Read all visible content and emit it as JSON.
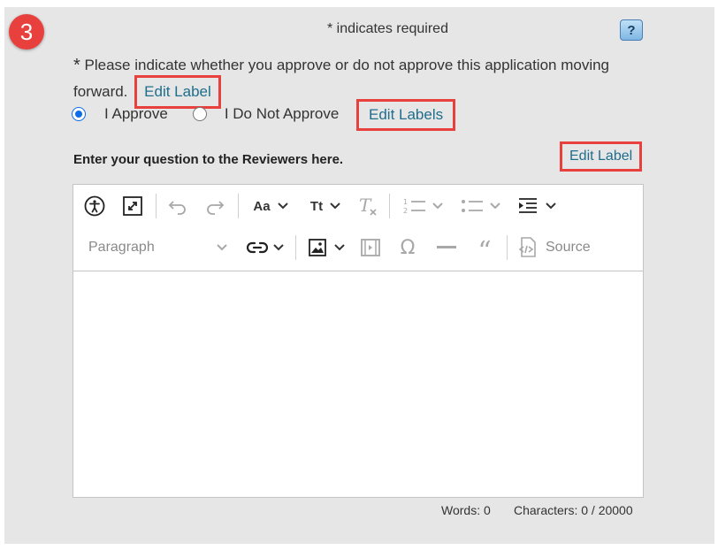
{
  "step_number": "3",
  "required_note": "* indicates required",
  "help_button_label": "?",
  "question": {
    "star": "*",
    "text": "Please indicate whether you approve or do not approve this application moving forward.",
    "edit_link": "Edit Label"
  },
  "radio_options": [
    {
      "label": "I Approve",
      "checked": true
    },
    {
      "label": "I Do Not Approve",
      "checked": false
    }
  ],
  "edit_labels_link": "Edit Labels",
  "reviewer_label": "Enter your question to the Reviewers here.",
  "reviewer_edit_link": "Edit Label",
  "editor": {
    "font_size_label": "Aa",
    "text_style_label": "Tt",
    "heading_select": "Paragraph",
    "source_label": "Source",
    "icons": [
      "accessibility-icon",
      "fullscreen-icon",
      "undo-icon",
      "redo-icon",
      "font-size-icon",
      "text-style-icon",
      "remove-format-icon",
      "numbered-list-icon",
      "bulleted-list-icon",
      "indent-icon",
      "link-icon",
      "image-icon",
      "media-icon",
      "special-characters-icon",
      "horizontal-line-icon",
      "blockquote-icon",
      "source-icon"
    ]
  },
  "word_count": "Words: 0",
  "character_count": "Characters: 0 / 20000",
  "colors": {
    "panel": "#e6e6e6",
    "badge": "#e8413d",
    "link": "#1f6e8c",
    "highlight": "#e8413d",
    "radio": "#0b6ee8"
  }
}
